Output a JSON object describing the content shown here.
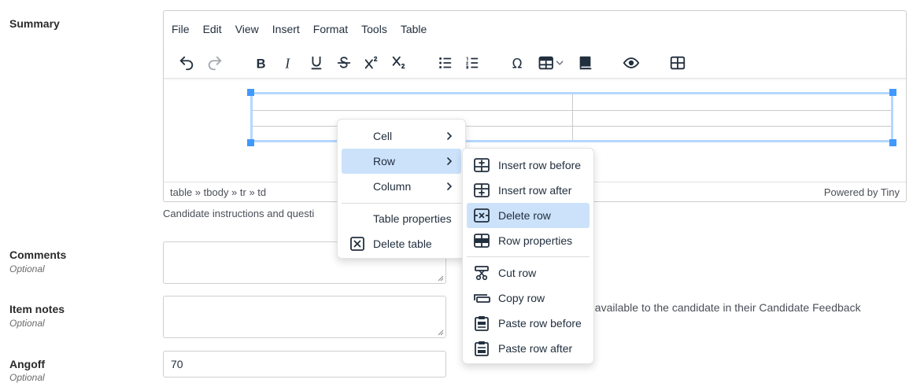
{
  "fields": {
    "summary_label": "Summary",
    "comments_label": "Comments",
    "comments_optional": "Optional",
    "item_notes_label": "Item notes",
    "item_notes_optional": "Optional",
    "item_notes_help": "le available to the candidate in their Candidate Feedback",
    "angoff_label": "Angoff",
    "angoff_optional": "Optional",
    "angoff_value": "70",
    "summary_help": "Candidate instructions and questi"
  },
  "editor": {
    "menubar": [
      "File",
      "Edit",
      "View",
      "Insert",
      "Format",
      "Tools",
      "Table"
    ],
    "statusbar_path": "table » tbody » tr » td",
    "statusbar_brand": "Powered by Tiny"
  },
  "toolbar_icons": [
    "undo-icon",
    "redo-icon",
    "bold-icon",
    "italic-icon",
    "underline-icon",
    "strikethrough-icon",
    "superscript-icon",
    "subscript-icon",
    "bullet-list-icon",
    "numbered-list-icon",
    "special-character-icon",
    "table-icon",
    "book-icon",
    "preview-icon",
    "grid-icon"
  ],
  "context_menu": {
    "items": [
      "Cell",
      "Row",
      "Column",
      "Table properties",
      "Delete table"
    ],
    "active": "Row"
  },
  "row_submenu": {
    "items": [
      "Insert row before",
      "Insert row after",
      "Delete row",
      "Row properties",
      "Cut row",
      "Copy row",
      "Paste row before",
      "Paste row after"
    ],
    "active": "Delete row"
  },
  "colors": {
    "accent": "#4099ff",
    "menu_highlight": "#cce2fa",
    "table_outline": "#b4d7ff"
  }
}
